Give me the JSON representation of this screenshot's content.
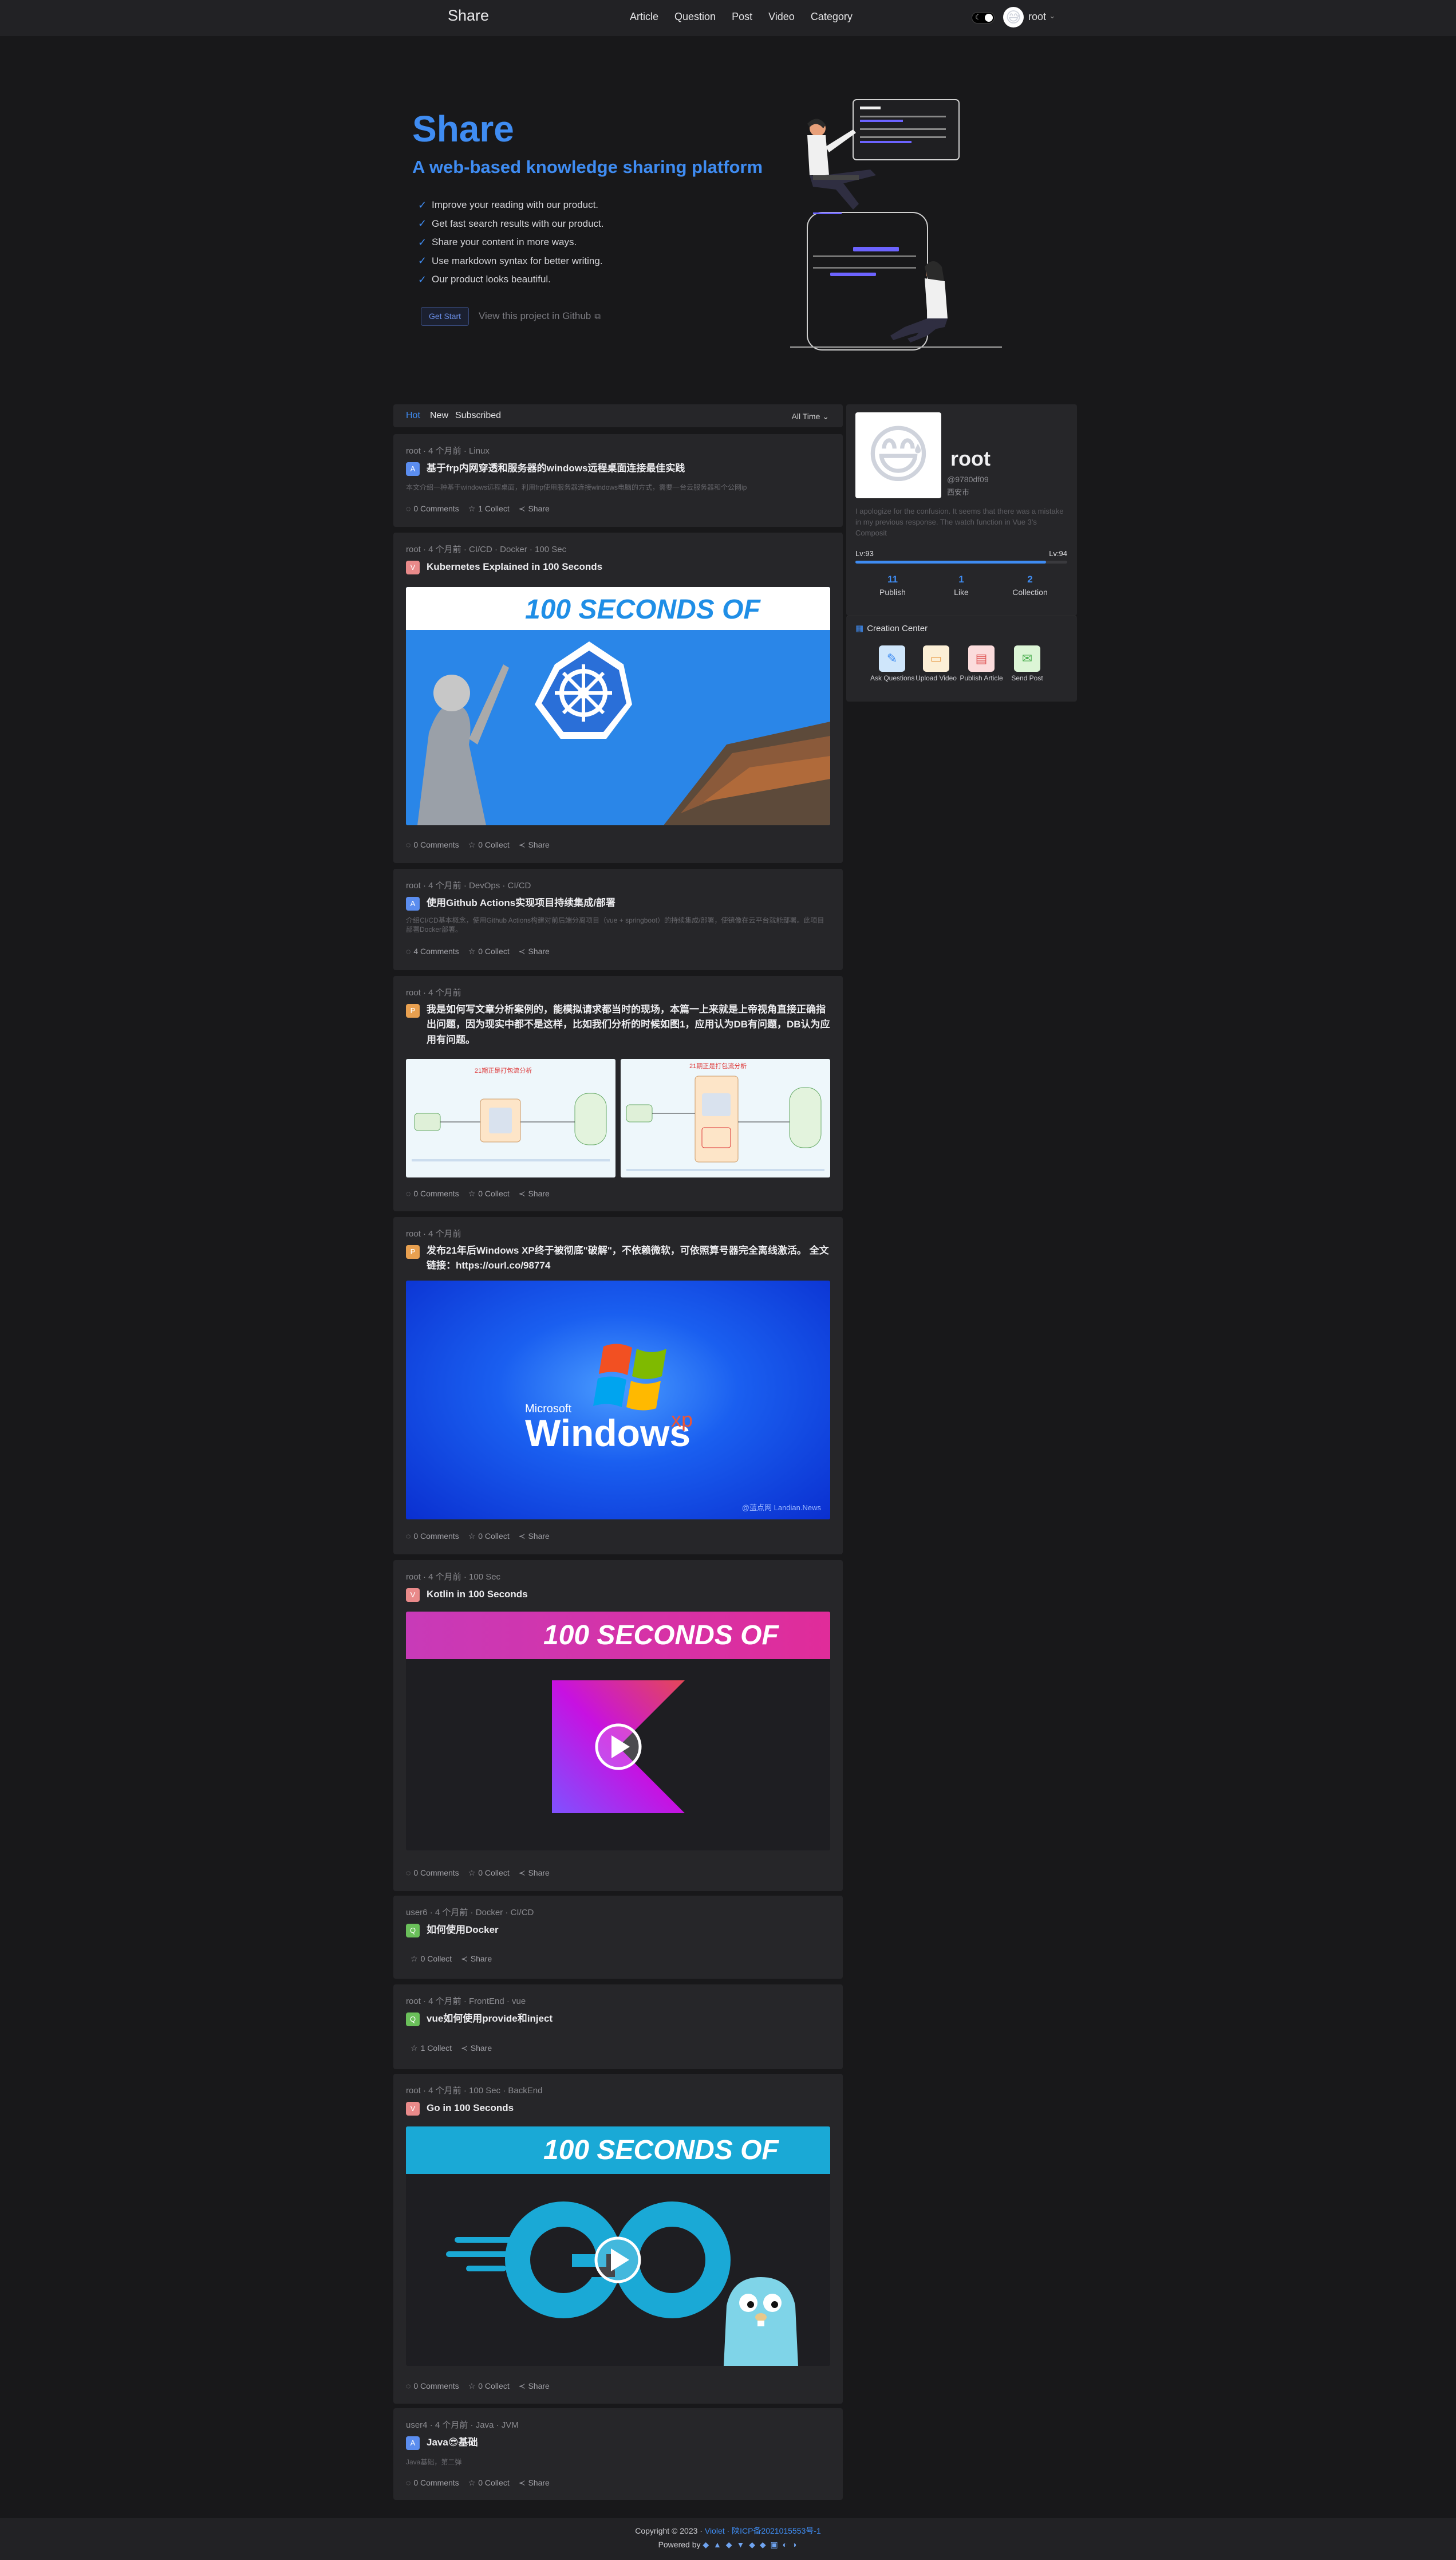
{
  "header": {
    "brand": "Share",
    "nav": [
      "Article",
      "Question",
      "Post",
      "Video",
      "Category"
    ],
    "user": "root"
  },
  "hero": {
    "title": "Share",
    "subtitle": "A web-based knowledge sharing platform",
    "features": [
      "Improve your reading with our product.",
      "Get fast search results with our product.",
      "Share your content in more ways.",
      "Use markdown syntax for better writing.",
      "Our product looks beautiful."
    ],
    "start_button": "Get Start",
    "github_link": "View this project in Github"
  },
  "feed": {
    "tabs": [
      "Hot",
      "New",
      "Subscribed"
    ],
    "active_tab": "Hot",
    "time_filter": "All Time",
    "items": [
      {
        "meta": "root · 4 个月前 · Linux",
        "title": "基于frp内网穿透和服务器的windows远程桌面连接最佳实践",
        "desc": "本文介绍一种基于windows远程桌面，利用frp使用服务器连接windows电脑的方式，需要一台云服务器和个公网ip",
        "comments": "0 Comments",
        "collect": "1 Collect",
        "share": "Share"
      },
      {
        "meta": "root · 4 个月前 · CI/CD · Docker · 100 Sec",
        "title": "Kubernetes Explained in 100 Seconds",
        "banner": "100 SECONDS OF",
        "comments": "0 Comments",
        "collect": "0 Collect",
        "share": "Share"
      },
      {
        "meta": "root · 4 个月前 · DevOps · CI/CD",
        "title": "使用Github Actions实现项目持续集成/部署",
        "desc": "介绍CI/CD基本概念，使用Github Actions构建对前后端分离项目（vue + springboot）的持续集成/部署，使镜像在云平台就能部署。此项目部署Docker部署。",
        "comments": "4 Comments",
        "collect": "0 Collect",
        "share": "Share"
      },
      {
        "meta": "root · 4 个月前",
        "title": "我是如何写文章分析案例的，能模拟请求都当时的现场，本篇一上来就是上帝视角直接正确指出问题，因为现实中都不是这样，比如我们分析的时候如图1，应用认为DB有问题，DB认为应用有问题。",
        "diagram_caption": "21期正是打包流分析",
        "comments": "0 Comments",
        "collect": "0 Collect",
        "share": "Share"
      },
      {
        "meta": "root · 4 个月前",
        "title": "发布21年后Windows XP终于被彻底\"破解\"，不依赖微软，可依照算号器完全离线激活。 全文链接：https://ourl.co/98774",
        "xp_brand": "Microsoft",
        "xp_word": "Windows",
        "xp_sup": "xp",
        "xp_watermark": "@蓝点网 Landian.News",
        "comments": "0 Comments",
        "collect": "0 Collect",
        "share": "Share"
      },
      {
        "meta": "root · 4 个月前 · 100 Sec",
        "title": "Kotlin in 100 Seconds",
        "banner": "100 SECONDS OF",
        "comments": "0 Comments",
        "collect": "0 Collect",
        "share": "Share"
      },
      {
        "meta": "user6 · 4 个月前 · Docker · CI/CD",
        "title": "如何使用Docker",
        "collect": "0 Collect",
        "share": "Share"
      },
      {
        "meta": "root · 4 个月前 · FrontEnd · vue",
        "title": "vue如何使用provide和inject",
        "collect": "1 Collect",
        "share": "Share"
      },
      {
        "meta": "root · 4 个月前 · 100 Sec · BackEnd",
        "title": "Go in 100 Seconds",
        "banner": "100 SECONDS OF",
        "comments": "0 Comments",
        "collect": "0 Collect",
        "share": "Share"
      },
      {
        "meta": "user4 · 4 个月前 · Java · JVM",
        "title": "Java😎基础",
        "desc": "Java基础，第二弹",
        "comments": "0 Comments",
        "collect": "0 Collect",
        "share": "Share"
      }
    ]
  },
  "profile": {
    "name": "root",
    "handle": "@9780df09",
    "location": "西安市",
    "bio": "I apologize for the confusion. It seems that there was a mistake in my previous response. The watch function in Vue 3's Composit",
    "level_left": "Lv:93",
    "level_right": "Lv:94",
    "progress": 0.9,
    "stats": [
      {
        "num": "11",
        "label": "Publish"
      },
      {
        "num": "1",
        "label": "Like"
      },
      {
        "num": "2",
        "label": "Collection"
      }
    ]
  },
  "creation": {
    "title": "Creation Center",
    "items": [
      {
        "label": "Ask Questions",
        "icon": "question-icon",
        "bg": "#cfe6fb"
      },
      {
        "label": "Upload Video",
        "icon": "video-icon",
        "bg": "#fcefd6"
      },
      {
        "label": "Publish Article",
        "icon": "article-icon",
        "bg": "#fbdcdc"
      },
      {
        "label": "Send Post",
        "icon": "post-icon",
        "bg": "#dcf5d6"
      }
    ]
  },
  "footer": {
    "copyright": "Copyright © 2023 ·",
    "author": "Violet",
    "icp": "· 陕ICP备2021015553号-1",
    "powered": "Powered by"
  },
  "colors": {
    "accent": "#3f8cf2",
    "bg": "#18181a",
    "card": "#262629"
  }
}
